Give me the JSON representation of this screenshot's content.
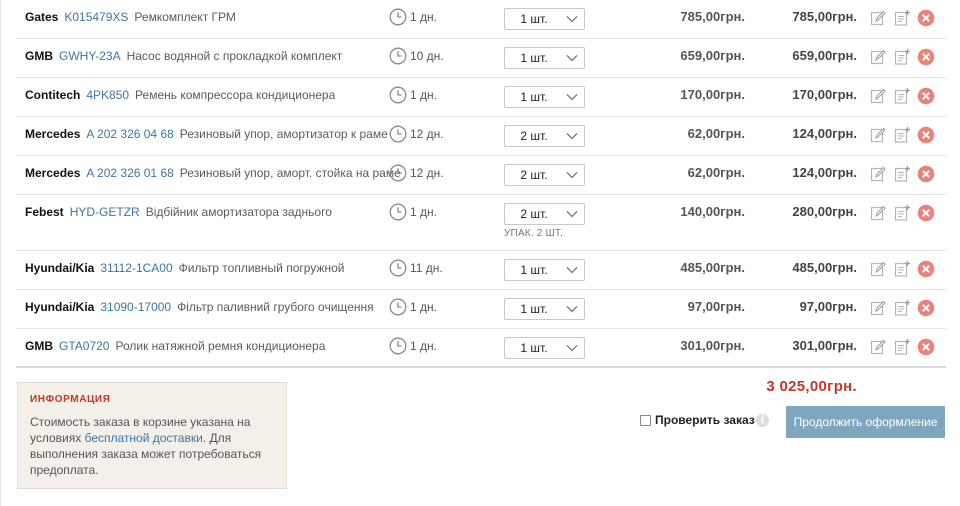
{
  "items": [
    {
      "brand": "Gates",
      "code": "K015479XS",
      "name": "Ремкомплект ГРМ",
      "delivery": "1 дн.",
      "qty": "1 шт.",
      "price": "785,00грн.",
      "sum": "785,00грн."
    },
    {
      "brand": "GMB",
      "code": "GWHY-23A",
      "name": "Насос водяной с прокладкой комплект",
      "delivery": "10 дн.",
      "qty": "1 шт.",
      "price": "659,00грн.",
      "sum": "659,00грн."
    },
    {
      "brand": "Contitech",
      "code": "4PK850",
      "name": "Ремень компрессора кондиционера",
      "delivery": "1 дн.",
      "qty": "1 шт.",
      "price": "170,00грн.",
      "sum": "170,00грн."
    },
    {
      "brand": "Mercedes",
      "code": "A 202 326 04 68",
      "name": "Резиновый упор, амортизатор к раме",
      "delivery": "12 дн.",
      "qty": "2 шт.",
      "price": "62,00грн.",
      "sum": "124,00грн."
    },
    {
      "brand": "Mercedes",
      "code": "A 202 326 01 68",
      "name": "Резиновый упор, аморт. стойка на раме",
      "delivery": "12 дн.",
      "qty": "2 шт.",
      "price": "62,00грн.",
      "sum": "124,00грн."
    },
    {
      "brand": "Febest",
      "code": "HYD-GETZR",
      "name": "Відбійник амортизатора заднього",
      "delivery": "1 дн.",
      "qty": "2 шт.",
      "pack_note": "УПАК. 2 ШТ.",
      "price": "140,00грн.",
      "sum": "280,00грн."
    },
    {
      "brand": "Hyundai/Kia",
      "code": "31112-1CA00",
      "name": "Фильтр топливный погружной",
      "delivery": "11 дн.",
      "qty": "1 шт.",
      "price": "485,00грн.",
      "sum": "485,00грн."
    },
    {
      "brand": "Hyundai/Kia",
      "code": "31090-17000",
      "name": "Фільтр паливний грубого очищення",
      "delivery": "1 дн.",
      "qty": "1 шт.",
      "price": "97,00грн.",
      "sum": "97,00грн."
    },
    {
      "brand": "GMB",
      "code": "GTA0720",
      "name": "Ролик натяжной ремня кондиционера",
      "delivery": "1 дн.",
      "qty": "1 шт.",
      "price": "301,00грн.",
      "sum": "301,00грн."
    }
  ],
  "info": {
    "title": "ИНФОРМАЦИЯ",
    "text_before": "Стоимость заказа в корзине указана на условиях ",
    "link": "бесплатной доставки",
    "text_after": ". Для выполнения заказа может потребоваться предоплата."
  },
  "total": "3 025,00грн.",
  "check_order_label": "Проверить заказ",
  "check_order_checked": false,
  "info_icon_glyph": "i",
  "continue_button": "Продолжить оформление",
  "icons": {
    "delivery": "clock-icon",
    "qty": "chevron-down-icon",
    "edit": "edit-note-icon",
    "add_note": "add-note-icon",
    "remove": "remove-circle-icon"
  },
  "colors": {
    "link": "#3d74a8",
    "total": "#c0392b",
    "remove": "#e8847a",
    "button": "#7ea6bf",
    "info_bg": "#f3f0e9"
  }
}
